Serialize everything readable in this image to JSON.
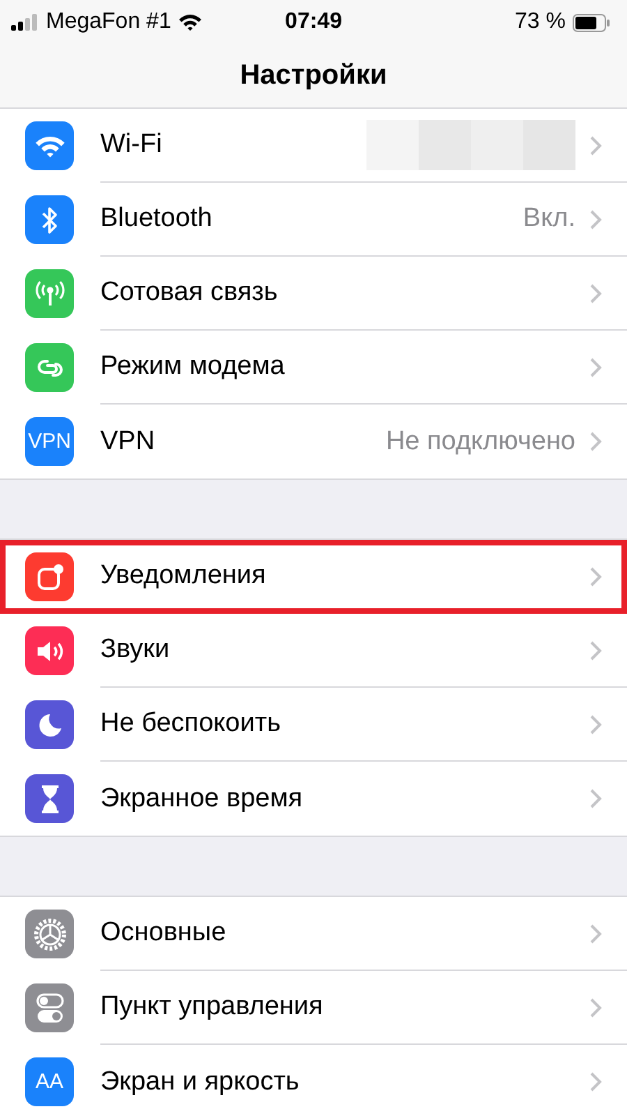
{
  "status_bar": {
    "carrier": "MegaFon #1",
    "time": "07:49",
    "battery": "73 %"
  },
  "nav": {
    "title": "Настройки"
  },
  "groups": [
    {
      "items": [
        {
          "kind": "wifi",
          "label": "Wi-Fi",
          "value_redacted": true,
          "highlighted": false
        },
        {
          "kind": "bluetooth",
          "label": "Bluetooth",
          "value": "Вкл.",
          "highlighted": false
        },
        {
          "kind": "cellular",
          "label": "Сотовая связь",
          "highlighted": false
        },
        {
          "kind": "hotspot",
          "label": "Режим модема",
          "highlighted": false
        },
        {
          "kind": "vpn",
          "label": "VPN",
          "icon_text": "VPN",
          "value": "Не подключено",
          "highlighted": false
        }
      ]
    },
    {
      "items": [
        {
          "kind": "notifications",
          "label": "Уведомления",
          "highlighted": true
        },
        {
          "kind": "sounds",
          "label": "Звуки",
          "highlighted": false
        },
        {
          "kind": "dnd",
          "label": "Не беспокоить",
          "highlighted": false
        },
        {
          "kind": "screentime",
          "label": "Экранное время",
          "highlighted": false
        }
      ]
    },
    {
      "items": [
        {
          "kind": "general",
          "label": "Основные",
          "highlighted": false
        },
        {
          "kind": "control",
          "label": "Пункт управления",
          "highlighted": false
        },
        {
          "kind": "display",
          "label": "Экран и яркость",
          "icon_text": "AA",
          "highlighted": false
        }
      ]
    }
  ]
}
